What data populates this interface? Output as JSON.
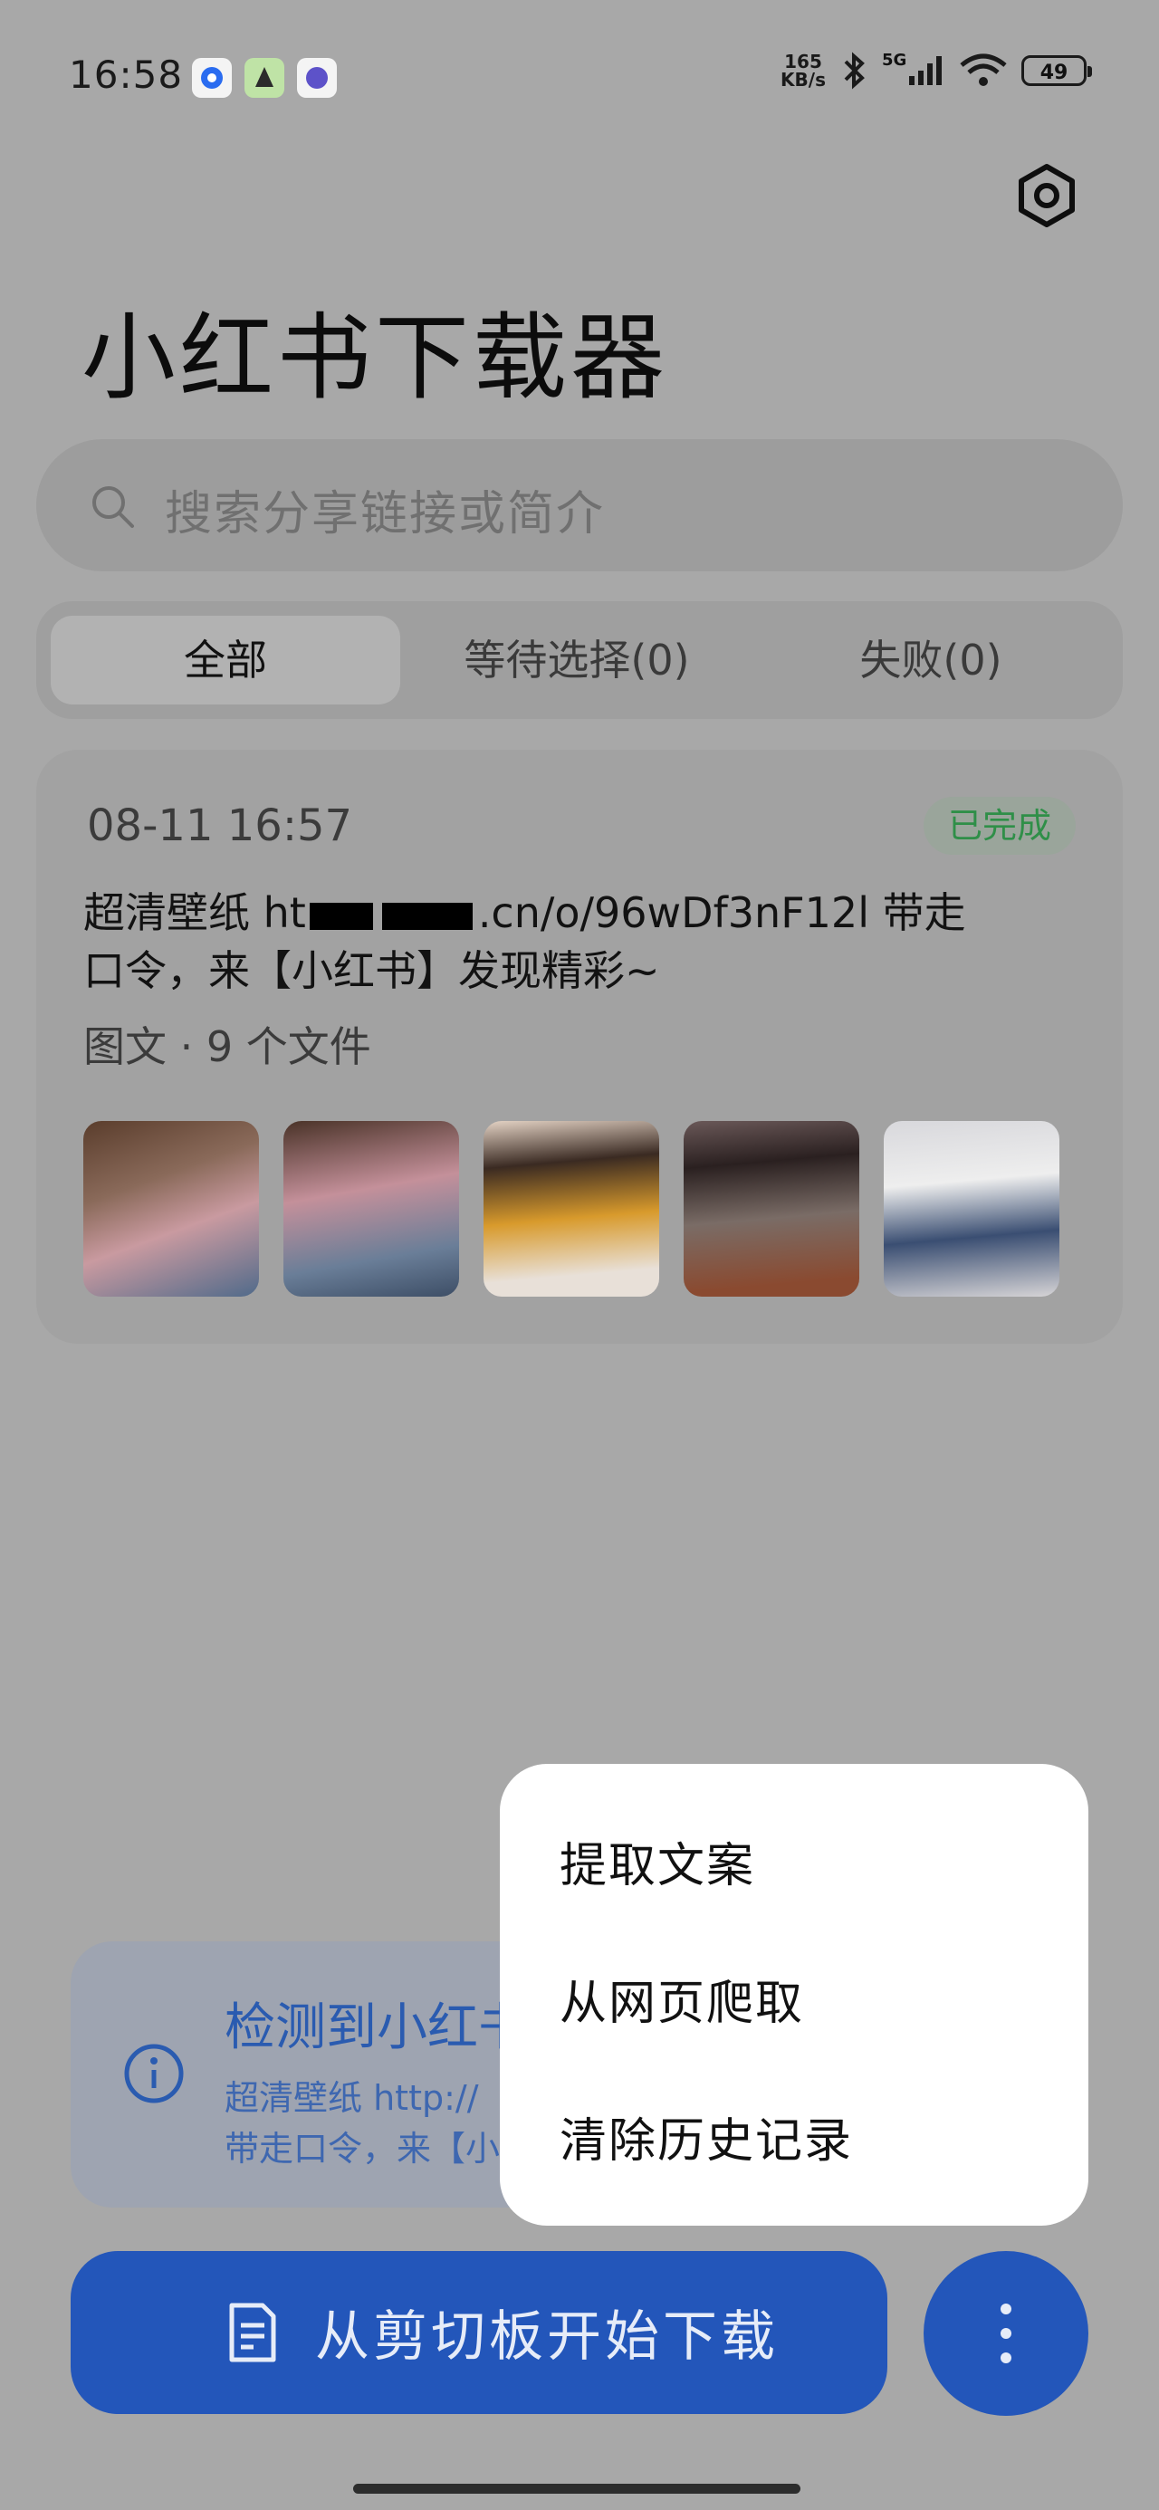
{
  "status_bar": {
    "time": "16:58",
    "speed_value": "165",
    "speed_unit": "KB/s",
    "network": "5G",
    "battery": "49"
  },
  "header": {
    "title": "小红书下载器",
    "settings_icon": "gear-icon"
  },
  "search": {
    "placeholder": "搜索分享链接或简介"
  },
  "tabs": [
    {
      "label": "全部",
      "active": true
    },
    {
      "label": "等待选择(0)",
      "active": false
    },
    {
      "label": "失败(0)",
      "active": false
    }
  ],
  "history_item": {
    "date": "08-11 16:57",
    "status": "已完成",
    "text_line1": "超清壁纸 ht",
    "text_line1_tail": ".cn/o/96wDf3nF12l 带走",
    "text_line2": "口令，来【小红书】发现精彩~",
    "meta": "图文 · 9 个文件"
  },
  "clipboard_notice": {
    "title": "检测到小红书",
    "line1": "超清壁纸 http://",
    "line2": "带走口令，来【小"
  },
  "menu": {
    "items": [
      "提取文案",
      "从网页爬取",
      "清除历史记录"
    ]
  },
  "bottom": {
    "download_label": "从剪切板开始下载",
    "more_icon": "more-vertical-icon"
  },
  "colors": {
    "accent": "#2356ba",
    "status_done": "#2f8f48"
  }
}
